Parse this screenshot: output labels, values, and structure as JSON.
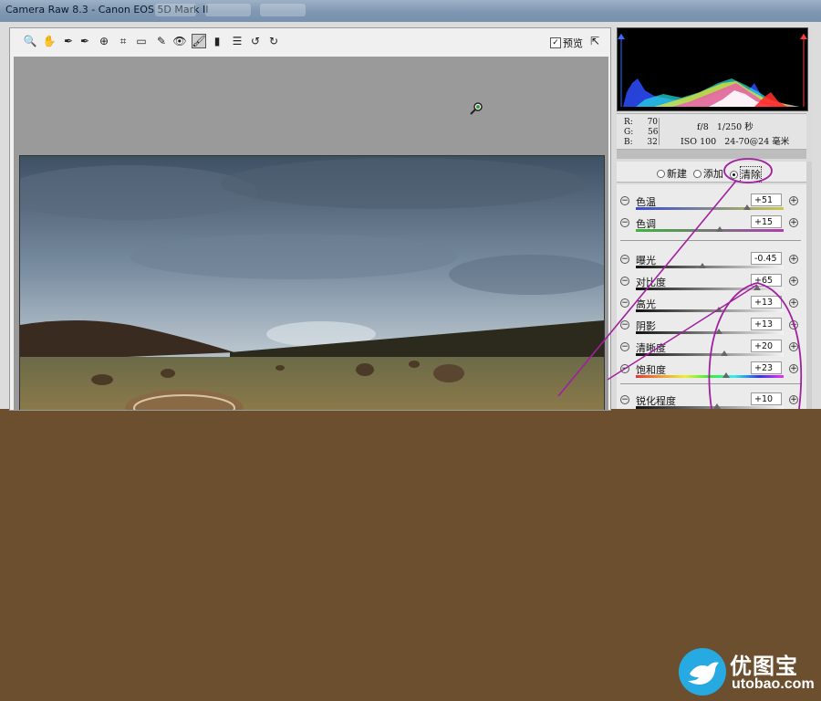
{
  "window": {
    "title": "Camera Raw 8.3 -  Canon EOS 5D Mark II"
  },
  "toolbar": {
    "tools": [
      {
        "name": "zoom-tool-icon",
        "glyph": "🔍"
      },
      {
        "name": "hand-tool-icon",
        "glyph": "✋"
      },
      {
        "name": "white-balance-tool-icon",
        "glyph": "✒"
      },
      {
        "name": "color-sampler-tool-icon",
        "glyph": "✒"
      },
      {
        "name": "targeted-adjustment-tool-icon",
        "glyph": "⊕"
      },
      {
        "name": "crop-tool-icon",
        "glyph": "⌗"
      },
      {
        "name": "straighten-tool-icon",
        "glyph": "▭"
      },
      {
        "name": "spot-removal-tool-icon",
        "glyph": "✎"
      },
      {
        "name": "red-eye-removal-tool-icon",
        "glyph": "👁"
      },
      {
        "name": "adjustment-brush-tool-icon",
        "glyph": "🖌"
      },
      {
        "name": "graduated-filter-tool-icon",
        "glyph": "▮"
      },
      {
        "name": "preferences-icon",
        "glyph": "☰"
      },
      {
        "name": "rotate-ccw-icon",
        "glyph": "↺"
      },
      {
        "name": "rotate-cw-icon",
        "glyph": "↻"
      }
    ],
    "preview_label": "预览",
    "preview_checked": true
  },
  "info": {
    "r_label": "R:",
    "r_value": "70",
    "g_label": "G:",
    "g_value": "56",
    "b_label": "B:",
    "b_value": "32",
    "aperture": "f/8",
    "shutter": "1/250 秒",
    "iso": "ISO 100",
    "lens": "24-70@24 毫米"
  },
  "modes": [
    {
      "label": "新建",
      "selected": false
    },
    {
      "label": "添加",
      "selected": false
    },
    {
      "label": "清除",
      "selected": true
    }
  ],
  "sliders": [
    {
      "key": "temperature",
      "label": "色温",
      "value": "+51",
      "level": 0.75
    },
    {
      "key": "tint",
      "label": "色调",
      "value": "+15",
      "level": 0.57
    },
    {
      "key": "exposure",
      "label": "曝光",
      "value": "-0.45",
      "level": 0.45
    },
    {
      "key": "contrast",
      "label": "对比度",
      "value": "+65",
      "level": 0.82
    },
    {
      "key": "highlights",
      "label": "高光",
      "value": "+13",
      "level": 0.56
    },
    {
      "key": "shadows",
      "label": "阴影",
      "value": "+13",
      "level": 0.56
    },
    {
      "key": "clarity",
      "label": "清晰度",
      "value": "+20",
      "level": 0.6
    },
    {
      "key": "saturation",
      "label": "饱和度",
      "value": "+23",
      "level": 0.61
    },
    {
      "key": "sharpness",
      "label": "锐化程度",
      "value": "+10",
      "level": 0.55
    }
  ],
  "colors": {
    "annotation": "#a11fa0",
    "background": "#6b4f2e"
  },
  "watermark": {
    "name": "优图宝",
    "url": "utobao.com"
  }
}
